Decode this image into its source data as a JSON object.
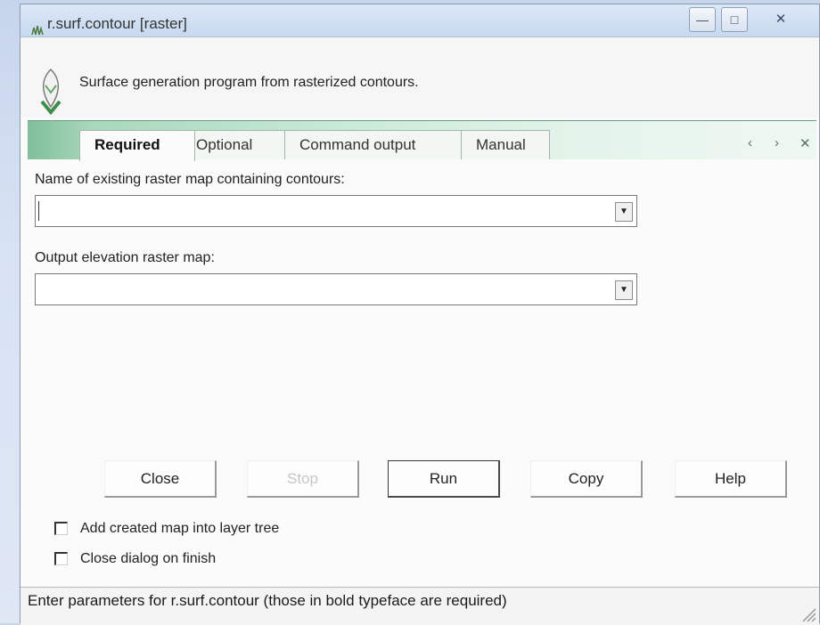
{
  "window": {
    "title": "r.surf.contour [raster]",
    "controls": {
      "minimize": "—",
      "maximize": "□",
      "close": "✕"
    }
  },
  "header": {
    "description": "Surface generation program from rasterized contours.",
    "icon": "grass-logo-icon"
  },
  "tabs": [
    {
      "label": "Required",
      "active": true
    },
    {
      "label": "Optional",
      "active": false
    },
    {
      "label": "Command output",
      "active": false
    },
    {
      "label": "Manual",
      "active": false
    }
  ],
  "tab_controls": {
    "prev": "‹",
    "next": "›",
    "close": "✕"
  },
  "fields": [
    {
      "label": "Name of existing raster map containing contours:",
      "value": "",
      "placeholder": ""
    },
    {
      "label": "Output elevation raster map:",
      "value": "",
      "placeholder": ""
    }
  ],
  "buttons": {
    "close": "Close",
    "stop": "Stop",
    "run": "Run",
    "copy": "Copy",
    "help": "Help"
  },
  "options": [
    {
      "label": "Add created map into layer tree",
      "checked": false
    },
    {
      "label": "Close dialog on finish",
      "checked": false
    }
  ],
  "status": {
    "text": "Enter parameters for r.surf.contour (those in bold typeface are required)"
  },
  "colors": {
    "tabstrip_start": "#7fbf9b",
    "tabstrip_end": "#eef8f2",
    "titlebar": "#cfdff2"
  }
}
